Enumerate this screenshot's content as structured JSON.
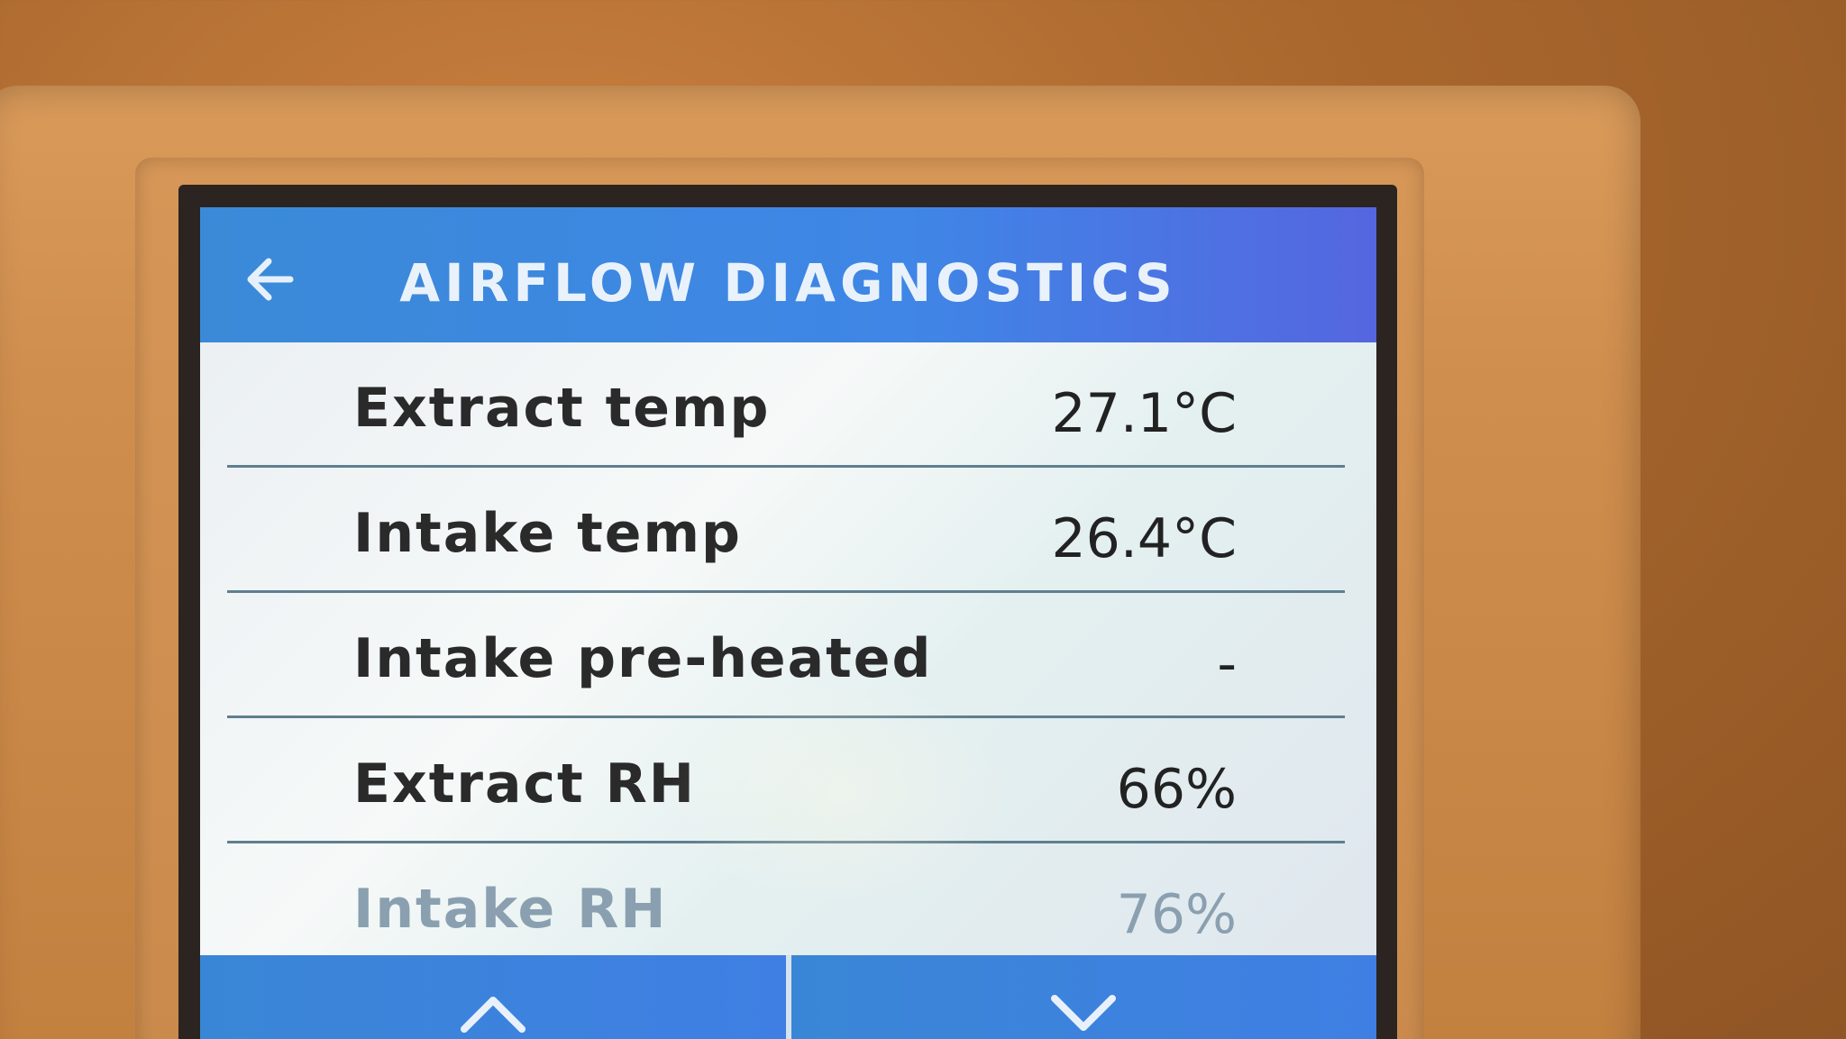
{
  "header": {
    "title": "AIRFLOW DIAGNOSTICS",
    "back_icon": "arrow-left-icon"
  },
  "rows": [
    {
      "label": "Extract temp",
      "value": "27.1°C"
    },
    {
      "label": "Intake temp",
      "value": "26.4°C"
    },
    {
      "label": "Intake pre-heated",
      "value": "-"
    },
    {
      "label": "Extract RH",
      "value": "66%"
    },
    {
      "label": "Intake RH",
      "value": "76%"
    }
  ],
  "footer": {
    "up_icon": "chevron-up-icon",
    "down_icon": "chevron-down-icon"
  },
  "colors": {
    "header_blue": "#3f86e6",
    "screen_bg": "#eef3f4",
    "bezel": "#cf8e4e"
  }
}
